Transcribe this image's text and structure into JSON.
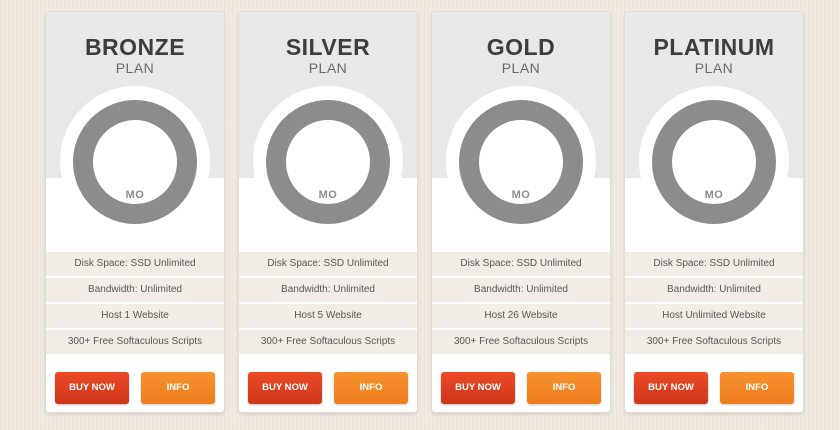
{
  "plans": [
    {
      "name": "BRONZE",
      "subtitle": "PLAN",
      "price_unit": "MO",
      "features": [
        "Disk Space: SSD Unlimited",
        "Bandwidth: Unlimited",
        "Host 1 Website",
        "300+ Free Softaculous Scripts"
      ],
      "buy_label": "BUY NOW",
      "info_label": "INFO"
    },
    {
      "name": "SILVER",
      "subtitle": "PLAN",
      "price_unit": "MO",
      "features": [
        "Disk Space: SSD Unlimited",
        "Bandwidth: Unlimited",
        "Host 5 Website",
        "300+ Free Softaculous Scripts"
      ],
      "buy_label": "BUY NOW",
      "info_label": "INFO"
    },
    {
      "name": "GOLD",
      "subtitle": "PLAN",
      "price_unit": "MO",
      "features": [
        "Disk Space: SSD Unlimited",
        "Bandwidth: Unlimited",
        "Host 26 Website",
        "300+ Free Softaculous Scripts"
      ],
      "buy_label": "BUY NOW",
      "info_label": "INFO"
    },
    {
      "name": "PLATINUM",
      "subtitle": "PLAN",
      "price_unit": "MO",
      "features": [
        "Disk Space: SSD Unlimited",
        "Bandwidth: Unlimited",
        "Host Unlimited Website",
        "300+ Free Softaculous Scripts"
      ],
      "buy_label": "BUY NOW",
      "info_label": "INFO"
    }
  ],
  "colors": {
    "background": "#efe9df",
    "ring": "#8c8c8c",
    "buy_button": "#e04327",
    "info_button": "#f58a27",
    "feature_row": "#f1ede6"
  }
}
